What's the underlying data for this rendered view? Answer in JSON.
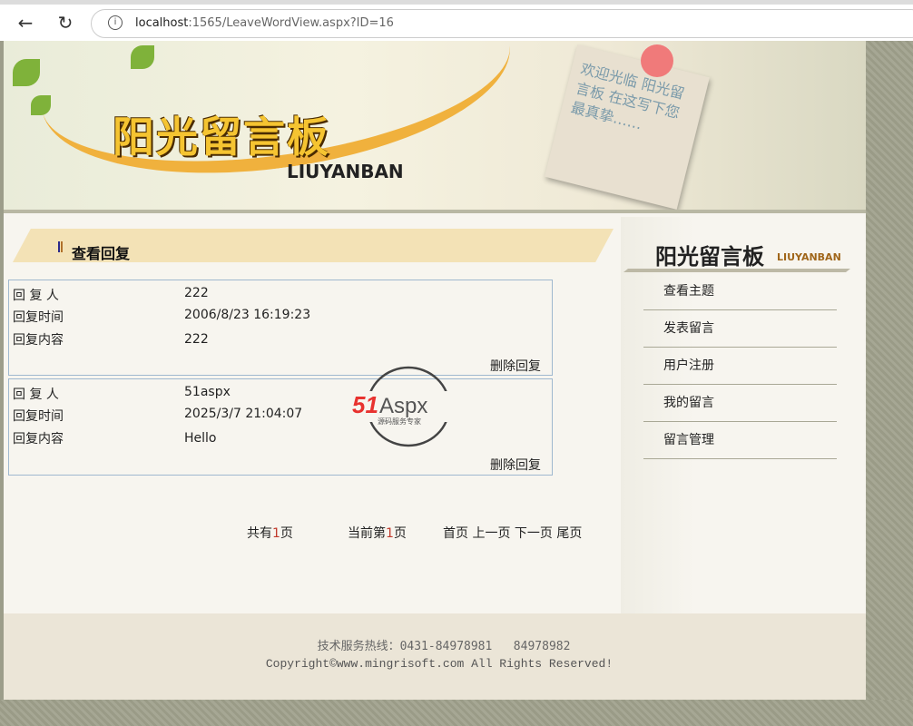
{
  "browser": {
    "url_host": "localhost",
    "url_rest": ":1565/LeaveWordView.aspx?ID=16"
  },
  "banner": {
    "logo": "阳光留言板",
    "logo_sub": "LIUYANBAN",
    "note_text": "欢迎光临 阳光留言板 在这写下您最真挚……"
  },
  "section_title": "查看回复",
  "labels": {
    "replier": "回 复 人",
    "time": "回复时间",
    "content": "回复内容",
    "delete": "删除回复"
  },
  "replies": [
    {
      "replier": "222",
      "time": "2006/8/23 16:19:23",
      "content": "222"
    },
    {
      "replier": "51aspx",
      "time": "2025/3/7 21:04:07",
      "content": "Hello"
    }
  ],
  "pager": {
    "total_prefix": "共有",
    "total": "1",
    "total_suffix": "页",
    "current_prefix": "当前第",
    "current": "1",
    "current_suffix": "页",
    "first": "首页",
    "prev": "上一页",
    "next": "下一页",
    "last": "尾页"
  },
  "watermark": {
    "text": "51Aspx",
    "sub": "源码服务专家"
  },
  "sidebar": {
    "title": "阳光留言板",
    "subtitle": "LIUYANBAN",
    "items": [
      {
        "label": "查看主题"
      },
      {
        "label": "发表留言"
      },
      {
        "label": "用户注册"
      },
      {
        "label": "我的留言"
      },
      {
        "label": "留言管理"
      }
    ]
  },
  "footer": {
    "hotline": "技术服务热线：0431-84978981   84978982",
    "copyright": "Copyright©www.mingrisoft.com All Rights Reserved!"
  }
}
